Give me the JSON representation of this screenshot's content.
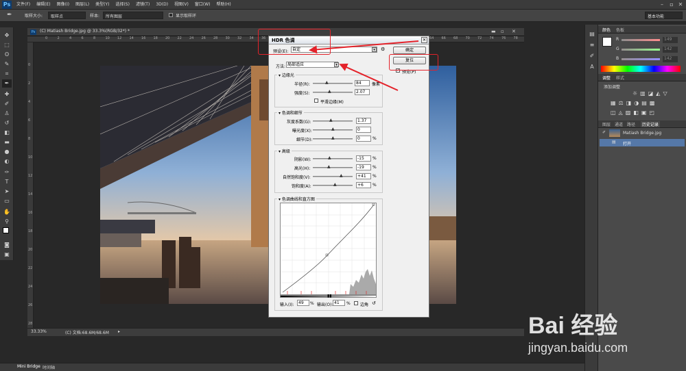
{
  "app": {
    "logo": "Ps"
  },
  "menu": [
    "文件(F)",
    "编辑(E)",
    "图像(I)",
    "图层(L)",
    "类型(Y)",
    "选择(S)",
    "滤镜(T)",
    "3D(D)",
    "视图(V)",
    "窗口(W)",
    "帮助(H)"
  ],
  "options": {
    "sample_size_label": "取样大小:",
    "sample_size_value": "取样点",
    "sample_label": "样本:",
    "sample_value": "所有图层",
    "show_ring": "显示取样环",
    "workspace": "基本功能"
  },
  "document": {
    "tab_title": "(C) Matiash Bridge.jpg @ 33.3%(RGB/32*) *",
    "zoom": "33.33%",
    "doc_info": "(C) 文档:68.6M/68.6M"
  },
  "ruler_h": [
    "0",
    "2",
    "4",
    "6",
    "8",
    "10",
    "12",
    "14",
    "16",
    "18",
    "20",
    "22",
    "24",
    "26",
    "28",
    "30",
    "32",
    "34",
    "36",
    "38",
    "40",
    "42",
    "44",
    "46",
    "48",
    "50",
    "52",
    "54",
    "56",
    "58",
    "60",
    "62",
    "64",
    "66",
    "68",
    "70",
    "72",
    "74",
    "76",
    "78",
    "80"
  ],
  "ruler_v": [
    "0",
    "2",
    "4",
    "6",
    "8",
    "10",
    "12",
    "14",
    "16",
    "18",
    "20",
    "22",
    "24",
    "26",
    "28"
  ],
  "bottom": {
    "mini_bridge": "Mini Bridge",
    "timeline": "时间轴"
  },
  "panels": {
    "color_tabs": [
      "颜色",
      "色板"
    ],
    "color_values": {
      "r": "149",
      "g": "142",
      "b": "142"
    },
    "color_labels": {
      "r": "R",
      "g": "G",
      "b": "B"
    },
    "adjust_tabs": [
      "调整",
      "样式"
    ],
    "adjust_title": "添加调整",
    "history_tabs": [
      "图层",
      "通道",
      "路径",
      "历史记录"
    ],
    "history_items": [
      {
        "label": "Matiash Bridge.jpg"
      },
      {
        "label": "打开"
      }
    ]
  },
  "dialog": {
    "title": "HDR 色调",
    "preset_label": "预设(E):",
    "preset_value": "自定",
    "ok": "确定",
    "reset": "复位",
    "preview": "预览(P)",
    "method_label": "方法:",
    "method_value": "局部适应",
    "edge_glow": {
      "title": "边缘光",
      "radius_label": "半径(R):",
      "radius_value": "84",
      "radius_unit": "像素",
      "strength_label": "强度(S):",
      "strength_value": "2.07",
      "smooth_label": "平滑边缘(M)"
    },
    "tone_detail": {
      "title": "色调和细节",
      "gamma_label": "灰度系数(G):",
      "gamma_value": "1.37",
      "exposure_label": "曝光度(X):",
      "exposure_value": "0",
      "detail_label": "细节(D):",
      "detail_value": "0",
      "detail_unit": "%"
    },
    "advanced": {
      "title": "高级",
      "shadow_label": "阴影(W):",
      "shadow_value": "-15",
      "highlight_label": "高光(H):",
      "highlight_value": "-19",
      "vibrance_label": "自然饱和度(V):",
      "vibrance_value": "+41",
      "saturation_label": "饱和度(A):",
      "saturation_value": "+6",
      "unit": "%"
    },
    "curve": {
      "title": "色调曲线和直方图",
      "input_label": "输入(I):",
      "input_value": "49",
      "output_label": "输出(O):",
      "output_value": "41",
      "unit": "%",
      "corner_label": "边角"
    }
  },
  "watermark": {
    "brand": "Bai 经验",
    "url": "jingyan.baidu.com"
  }
}
